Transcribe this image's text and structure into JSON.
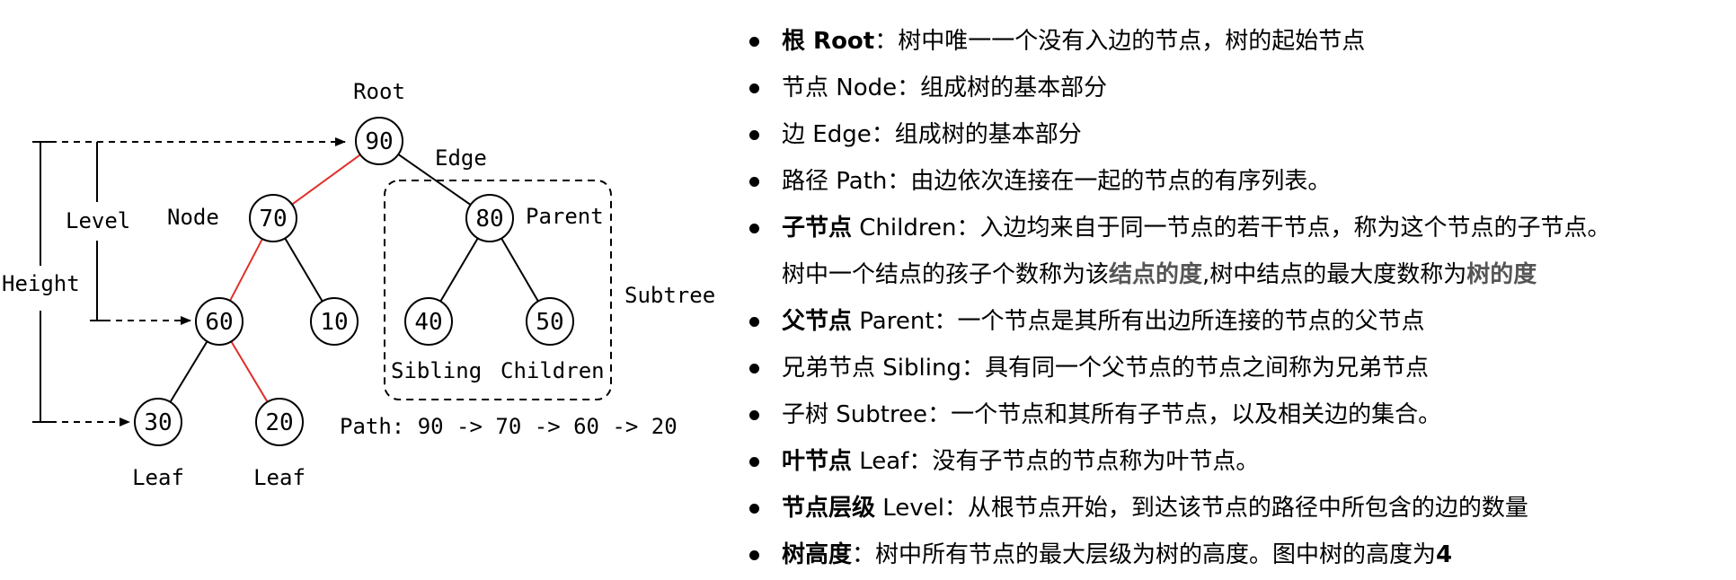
{
  "tree": {
    "nodes": [
      {
        "id": "n90",
        "label": "90"
      },
      {
        "id": "n70",
        "label": "70"
      },
      {
        "id": "n80",
        "label": "80"
      },
      {
        "id": "n60",
        "label": "60"
      },
      {
        "id": "n10",
        "label": "10"
      },
      {
        "id": "n40",
        "label": "40"
      },
      {
        "id": "n50",
        "label": "50"
      },
      {
        "id": "n30",
        "label": "30"
      },
      {
        "id": "n20",
        "label": "20"
      }
    ],
    "edges": [
      {
        "from": "n90",
        "to": "n70",
        "highlight": true
      },
      {
        "from": "n90",
        "to": "n80",
        "highlight": false
      },
      {
        "from": "n70",
        "to": "n60",
        "highlight": true
      },
      {
        "from": "n70",
        "to": "n10",
        "highlight": false
      },
      {
        "from": "n80",
        "to": "n40",
        "highlight": false
      },
      {
        "from": "n80",
        "to": "n50",
        "highlight": false
      },
      {
        "from": "n60",
        "to": "n30",
        "highlight": false
      },
      {
        "from": "n60",
        "to": "n20",
        "highlight": true
      }
    ],
    "highlight_color": "#e0302a",
    "labels": {
      "root": "Root",
      "edge": "Edge",
      "node": "Node",
      "parent": "Parent",
      "subtree": "Subtree",
      "level": "Level",
      "height": "Height",
      "sibling": "Sibling",
      "children": "Children",
      "leaf_left": "Leaf",
      "leaf_right": "Leaf",
      "path": "Path: 90 -> 70 -> 60 -> 20"
    }
  },
  "definitions": [
    {
      "bullet": true,
      "term": "根 Root",
      "term_bold": true,
      "desc": "：树中唯一一个没有入边的节点，树的起始节点"
    },
    {
      "bullet": true,
      "term": "节点 Node",
      "term_bold": false,
      "desc": "：组成树的基本部分"
    },
    {
      "bullet": true,
      "term": "边 Edge",
      "term_bold": false,
      "desc": "：组成树的基本部分"
    },
    {
      "bullet": true,
      "term": "路径 Path",
      "term_bold": false,
      "desc": "：由边依次连接在一起的节点的有序列表。"
    },
    {
      "bullet": true,
      "term": "子节点",
      "term_bold": true,
      "term_rest": " Children",
      "desc": "：入边均来自于同一节点的若干节点，称为这个节点的子节点。"
    },
    {
      "bullet": false,
      "term": "",
      "term_bold": false,
      "desc": "树中一个结点的孩子个数称为该",
      "emph1": "结点的度",
      "desc2": ",树中结点的最大度数称为",
      "emph2": "树的度"
    },
    {
      "bullet": true,
      "term": "父节点",
      "term_bold": true,
      "term_rest": " Parent",
      "desc": "：一个节点是其所有出边所连接的节点的父节点"
    },
    {
      "bullet": true,
      "term": "兄弟节点 Sibling",
      "term_bold": false,
      "desc": "：具有同一个父节点的节点之间称为兄弟节点"
    },
    {
      "bullet": true,
      "term": "子树 Subtree",
      "term_bold": false,
      "desc": "：一个节点和其所有子节点，以及相关边的集合。"
    },
    {
      "bullet": true,
      "term": "叶节点",
      "term_bold": true,
      "term_rest": " Leaf",
      "desc": "：没有子节点的节点称为叶节点。"
    },
    {
      "bullet": true,
      "term": "节点层级",
      "term_bold": true,
      "term_rest": " Level",
      "desc": "：从根节点开始，到达该节点的路径中所包含的边的数量"
    },
    {
      "bullet": true,
      "term": "树高度",
      "term_bold": true,
      "desc": "：树中所有节点的最大层级为树的高度。图中树的高度为",
      "value": "4"
    }
  ]
}
